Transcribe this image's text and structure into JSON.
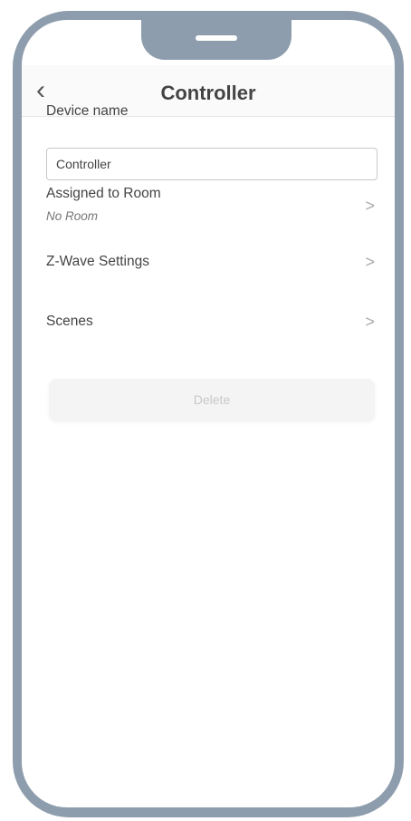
{
  "nav": {
    "back_icon": "back-chevron-icon",
    "title": "Controller"
  },
  "device_name": {
    "label": "Device name",
    "value": "Controller"
  },
  "rows": [
    {
      "title": "Assigned to Room",
      "subtitle": "No Room",
      "chevron": ">"
    },
    {
      "title": "Z-Wave Settings",
      "chevron": ">"
    },
    {
      "title": "Scenes",
      "chevron": ">"
    }
  ],
  "delete_button": {
    "label": "Delete"
  },
  "colors": {
    "frame": "#8e9dad",
    "text": "#444444"
  }
}
